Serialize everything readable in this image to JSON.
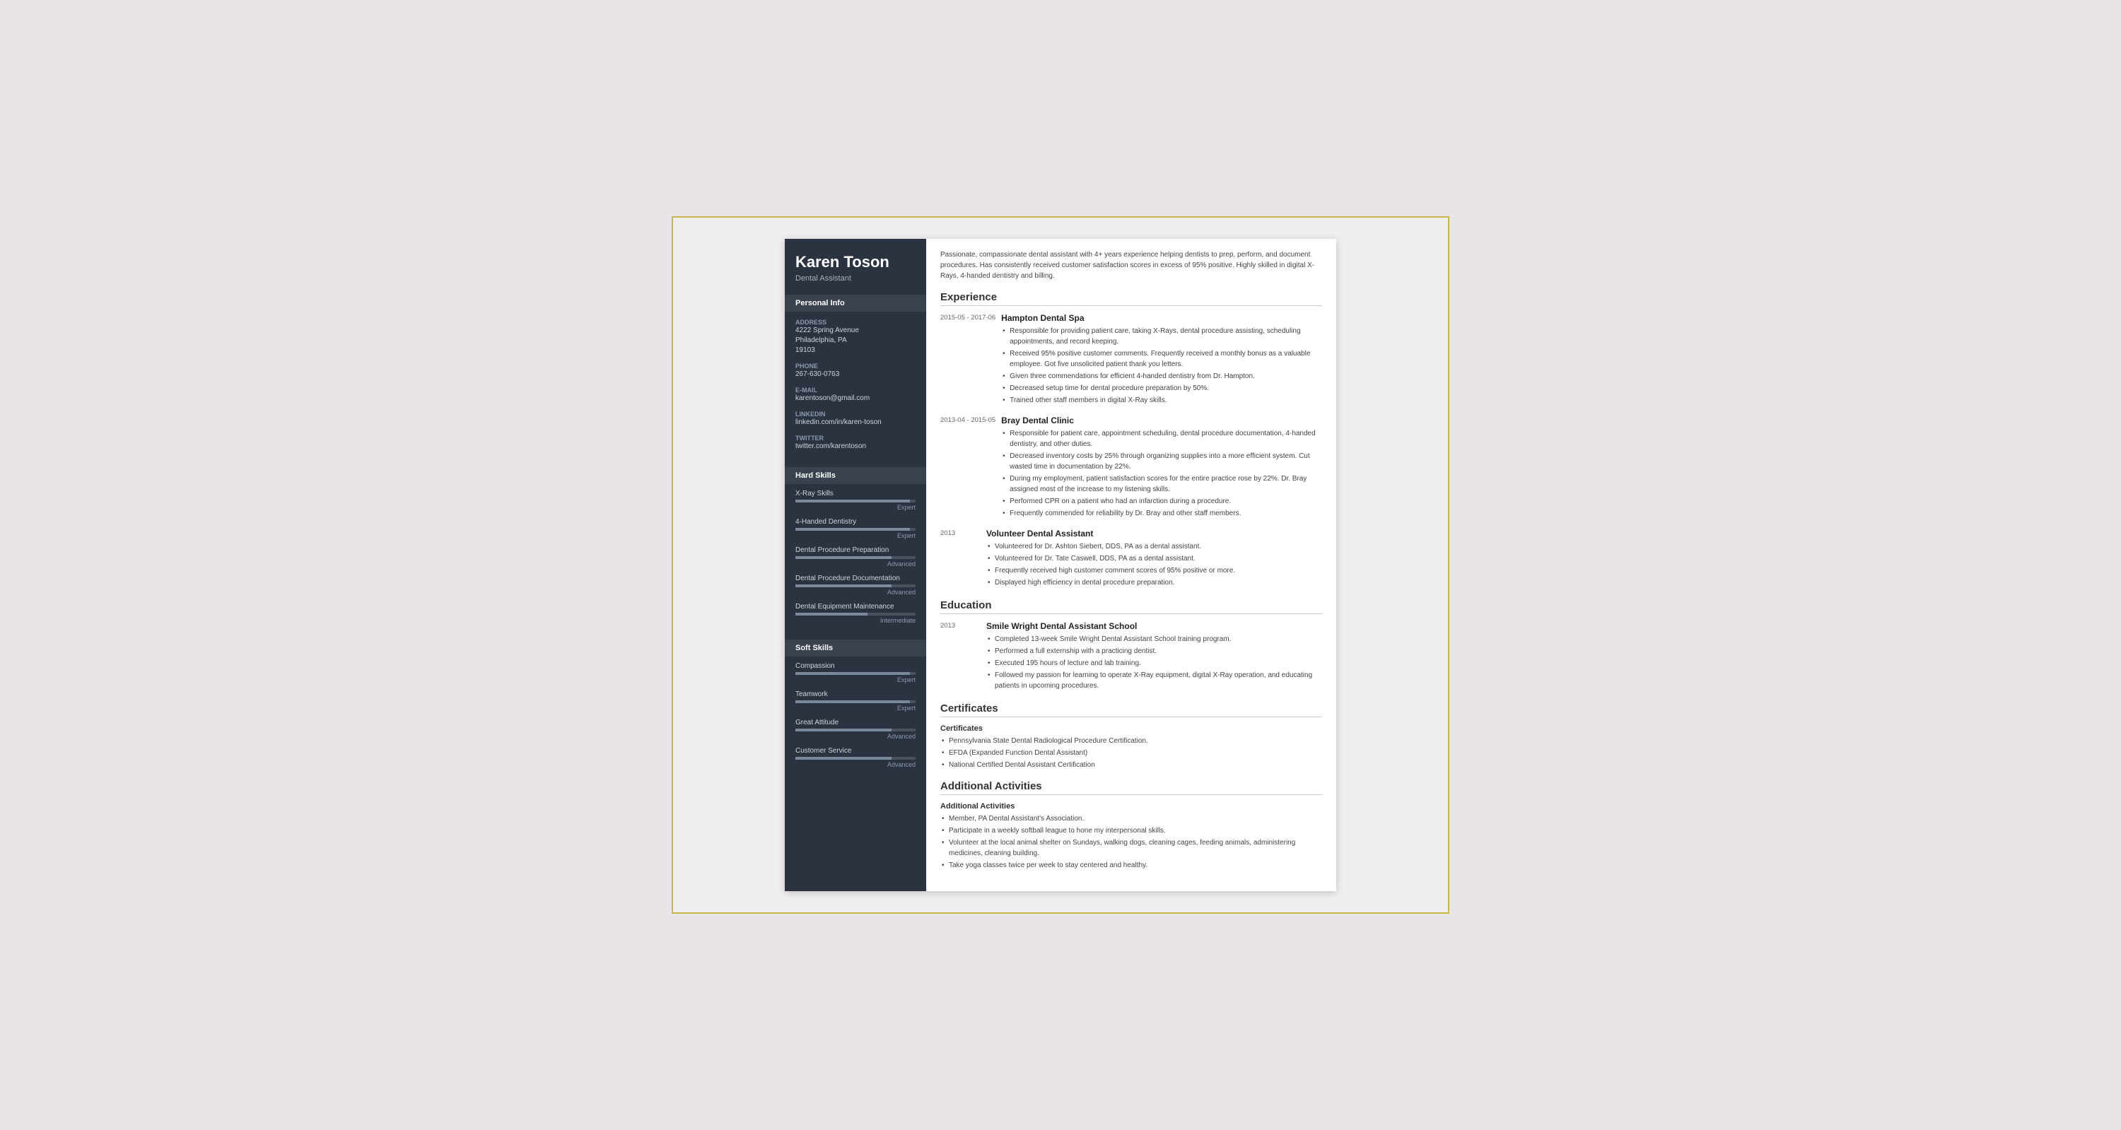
{
  "resume": {
    "name": "Karen Toson",
    "title": "Dental Assistant",
    "summary": "Passionate, compassionate dental assistant with 4+ years experience helping dentists to prep, perform, and document procedures. Has consistently received customer satisfaction scores in excess of 95% positive. Highly skilled in digital X-Rays, 4-handed dentistry and billing.",
    "personal": {
      "address_label": "Address",
      "address_value": "4222 Spring Avenue\nPhiladelphia, PA\n19103",
      "phone_label": "Phone",
      "phone_value": "267-630-0763",
      "email_label": "E-mail",
      "email_value": "karentoson@gmail.com",
      "linkedin_label": "LinkedIn",
      "linkedin_value": "linkedin.com/in/karen-toson",
      "twitter_label": "Twitter",
      "twitter_value": "twitter.com/karentoson"
    },
    "hard_skills_label": "Hard Skills",
    "hard_skills": [
      {
        "name": "X-Ray Skills",
        "level": "Expert",
        "pct": 95
      },
      {
        "name": "4-Handed Dentistry",
        "level": "Expert",
        "pct": 95
      },
      {
        "name": "Dental Procedure Preparation",
        "level": "Advanced",
        "pct": 80
      },
      {
        "name": "Dental Procedure Documentation",
        "level": "Advanced",
        "pct": 80
      },
      {
        "name": "Dental Equipment Maintenance",
        "level": "Intermediate",
        "pct": 60
      }
    ],
    "soft_skills_label": "Soft Skills",
    "soft_skills": [
      {
        "name": "Compassion",
        "level": "Expert",
        "pct": 95
      },
      {
        "name": "Teamwork",
        "level": "Expert",
        "pct": 95
      },
      {
        "name": "Great Attitude",
        "level": "Advanced",
        "pct": 80
      },
      {
        "name": "Customer Service",
        "level": "Advanced",
        "pct": 80
      }
    ],
    "experience_label": "Experience",
    "experience": [
      {
        "date": "2015-05 - 2017-06",
        "company": "Hampton Dental Spa",
        "bullets": [
          "Responsible for providing patient care, taking X-Rays, dental procedure assisting, scheduling appointments, and record keeping.",
          "Received 95% positive customer comments. Frequently received a monthly bonus as a valuable employee. Got five unsolicited patient thank you letters.",
          "Given three commendations for efficient 4-handed dentistry from Dr. Hampton.",
          "Decreased setup time for dental procedure preparation by 50%.",
          "Trained other staff members in digital X-Ray skills."
        ]
      },
      {
        "date": "2013-04 - 2015-05",
        "company": "Bray Dental Clinic",
        "bullets": [
          "Responsible for patient care, appointment scheduling, dental procedure documentation, 4-handed dentistry, and other duties.",
          "Decreased inventory costs by 25% through organizing supplies into a more efficient system. Cut wasted time in documentation by 22%.",
          "During my employment, patient satisfaction scores for the entire practice rose by 22%. Dr. Bray assigned most of the increase to my listening skills.",
          "Performed CPR on a patient who had an infarction during a procedure.",
          "Frequently commended for reliability by Dr. Bray and other staff members."
        ]
      },
      {
        "date": "2013",
        "company": "Volunteer Dental Assistant",
        "bullets": [
          "Volunteered for Dr. Ashton Siebert, DDS, PA as a dental assistant.",
          "Volunteered for Dr. Tate Caswell, DDS, PA as a dental assistant.",
          "Frequently received high customer comment scores of 95% positive or more.",
          "Displayed high efficiency in dental procedure preparation."
        ]
      }
    ],
    "education_label": "Education",
    "education": [
      {
        "date": "2013",
        "school": "Smile Wright Dental Assistant School",
        "bullets": [
          "Completed 13-week Smile Wright Dental Assistant School training program.",
          "Performed a full externship with a practicing dentist.",
          "Executed 195 hours of lecture and lab training.",
          "Followed my passion for learning to operate X-Ray equipment, digital X-Ray operation, and educating patients in upcoming procedures."
        ]
      }
    ],
    "certificates_label": "Certificates",
    "certificates": {
      "section_title": "Certificates",
      "items": [
        "Pennsylvania State Dental Radiological Procedure Certification.",
        "EFDA (Expanded Function Dental Assistant)",
        "National Certified Dental Assistant Certification"
      ]
    },
    "activities_label": "Additional Activities",
    "activities": {
      "section_title": "Additional Activities",
      "items": [
        "Member, PA Dental Assistant's Association.",
        "Participate in a weekly softball league to hone my interpersonal skills.",
        "Volunteer at the local animal shelter on Sundays, walking dogs, cleaning cages, feeding animals, administering medicines, cleaning building.",
        "Take yoga classes twice per week to stay centered and healthy."
      ]
    }
  }
}
